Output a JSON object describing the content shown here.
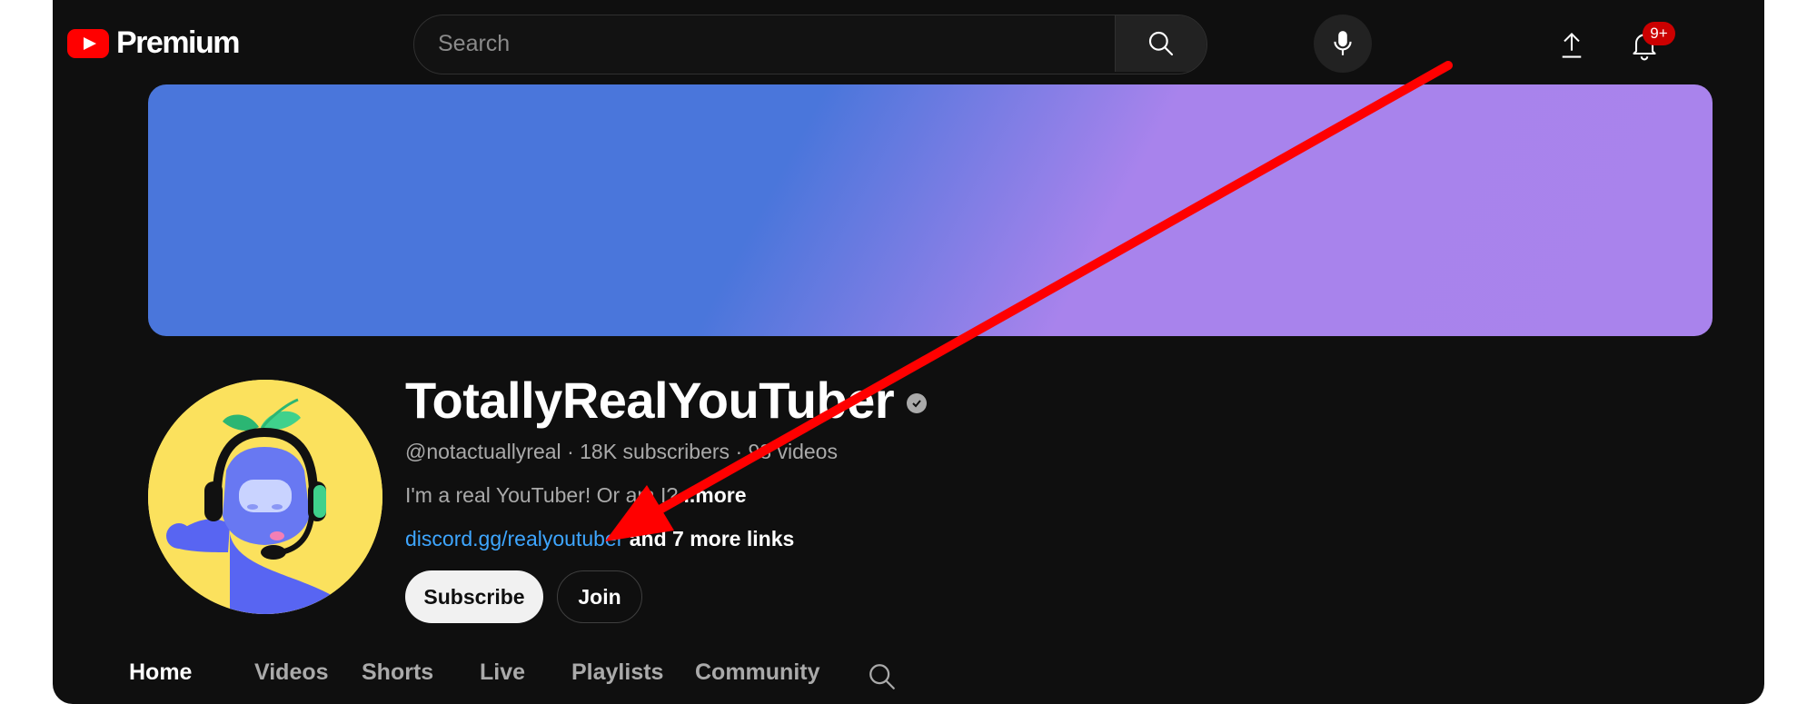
{
  "topbar": {
    "logo_text": "Premium",
    "search_placeholder": "Search",
    "notification_badge": "9+"
  },
  "channel": {
    "name": "TotallyRealYouTuber",
    "handle": "@notactuallyreal",
    "subscribers": "18K subscribers",
    "videos": "98 videos",
    "description": "I'm a real YouTuber! Or am I?",
    "description_more": "...more",
    "link": "discord.gg/realyoutuber",
    "more_links": "and 7 more links",
    "subscribe_label": "Subscribe",
    "join_label": "Join"
  },
  "tabs": [
    "Home",
    "Videos",
    "Shorts",
    "Live",
    "Playlists",
    "Community"
  ],
  "active_tab": "Home",
  "colors": {
    "background": "#0f0f0f",
    "banner_blue": "#4a76db",
    "banner_purple": "#a983ec",
    "link": "#3ea6ff",
    "annotation_arrow": "#ff0000",
    "avatar_background": "#fbe15d"
  },
  "icons": [
    "youtube-logo-icon",
    "search-icon",
    "microphone-icon",
    "upload-icon",
    "bell-icon",
    "verified-icon",
    "annotation-arrow-icon"
  ]
}
